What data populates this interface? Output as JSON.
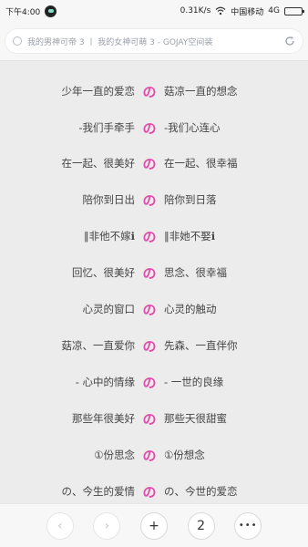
{
  "status_bar": {
    "time": "下午4:00",
    "speed": "0.31K/s",
    "carrier": "中国移动",
    "network": "4G"
  },
  "address_bar": {
    "text": "我的男神可帝 3 丨 我的女神可萌 3 - GOJAY空间装"
  },
  "pairs": [
    {
      "left": "少年一直的爱恋",
      "mid": "の",
      "right": "菇凉一直的想念"
    },
    {
      "left": "-我们手牵手",
      "mid": "の",
      "right": "-我们心连心"
    },
    {
      "left": "在一起、很美好",
      "mid": "の",
      "right": "在一起、很幸福"
    },
    {
      "left": "陪你到日出",
      "mid": "の",
      "right": "陪你到日落"
    },
    {
      "left": "‖非他不嫁ℹ",
      "mid": "の",
      "right": "‖非她不娶ℹ"
    },
    {
      "left": "回忆、很美好",
      "mid": "の",
      "right": "思念、很幸福"
    },
    {
      "left": "心灵的窗口",
      "mid": "の",
      "right": "心灵的触动"
    },
    {
      "left": "菇凉、一直爱你",
      "mid": "の",
      "right": "先森、一直伴你"
    },
    {
      "left": "- 心中的情缘",
      "mid": "の",
      "right": "- 一世的良缘"
    },
    {
      "left": "那些年很美好",
      "mid": "の",
      "right": "那些天很甜蜜"
    },
    {
      "left": "①份思念",
      "mid": "の",
      "right": "①份想念"
    },
    {
      "left": "の、今生的爱情",
      "mid": "の",
      "right": "の、今世的爱恋"
    }
  ],
  "bottom_bar": {
    "back": "‹",
    "forward": "›",
    "add": "+",
    "tab_count": "2",
    "menu": "•••"
  },
  "colors": {
    "accent": "#e24aa9",
    "content_bg": "#ececec"
  }
}
